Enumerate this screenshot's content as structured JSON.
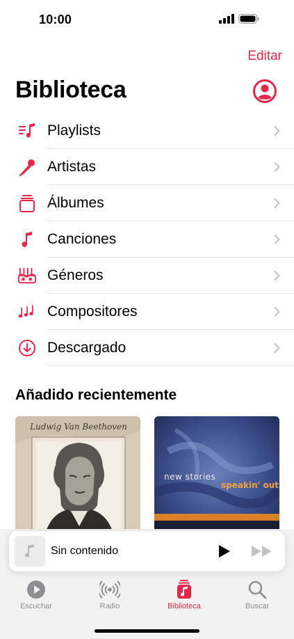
{
  "status": {
    "time": "10:00"
  },
  "header": {
    "edit_label": "Editar",
    "title": "Biblioteca"
  },
  "menu": [
    {
      "label": "Playlists",
      "icon": "playlist-icon"
    },
    {
      "label": "Artistas",
      "icon": "microphone-icon"
    },
    {
      "label": "Álbumes",
      "icon": "album-stack-icon"
    },
    {
      "label": "Canciones",
      "icon": "music-note-icon"
    },
    {
      "label": "Géneros",
      "icon": "genres-icon"
    },
    {
      "label": "Compositores",
      "icon": "composers-icon"
    },
    {
      "label": "Descargado",
      "icon": "download-icon"
    }
  ],
  "recent": {
    "title": "Añadido recientemente",
    "albums": [
      {
        "cover_text": "Ludwig Van Beethoven"
      },
      {
        "cover_text_1": "new stories",
        "cover_text_2": "speakin' out"
      }
    ]
  },
  "mini_player": {
    "title": "Sin contenido"
  },
  "tabs": [
    {
      "label": "Escuchar"
    },
    {
      "label": "Radio"
    },
    {
      "label": "Biblioteca"
    },
    {
      "label": "Buscar"
    }
  ],
  "colors": {
    "accent": "#e8264a",
    "inactive": "#8e8e93"
  }
}
